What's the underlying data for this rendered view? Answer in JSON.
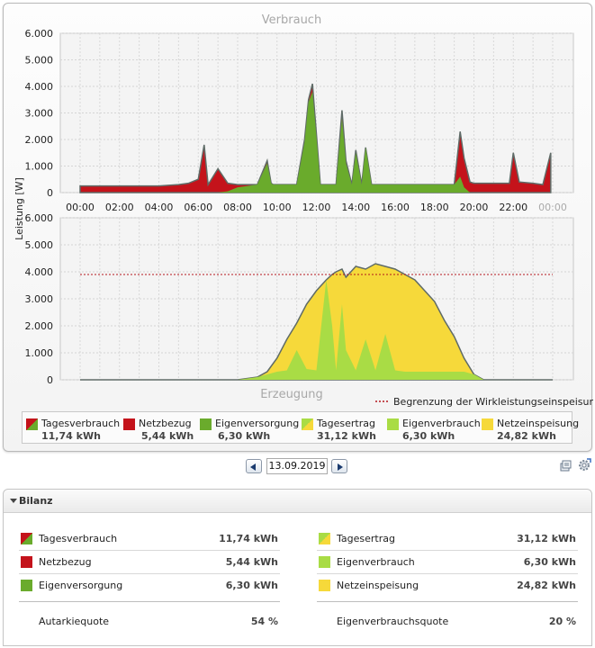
{
  "colors": {
    "red": "#c4131b",
    "green": "#6aab2c",
    "yellow": "#f6d93a",
    "lightgreen": "#a9dc45",
    "outline": "#5f6b67",
    "limit": "#b3161c"
  },
  "chart_data": [
    {
      "type": "area",
      "title": "Verbrauch",
      "ylabel": "Leistung [W]",
      "ylim": [
        0,
        6000
      ],
      "yticks": [
        "0",
        "1.000",
        "2.000",
        "3.000",
        "4.000",
        "5.000",
        "6.000"
      ],
      "xticks": [
        "00:00",
        "02:00",
        "04:00",
        "06:00",
        "08:00",
        "10:00",
        "12:00",
        "14:00",
        "16:00",
        "18:00",
        "20:00",
        "22:00",
        "00:00"
      ],
      "x_hours": [
        0,
        1,
        2,
        3,
        4,
        5,
        5.5,
        6,
        6.3,
        6.5,
        7,
        7.5,
        8,
        9,
        9.5,
        9.7,
        9.8,
        10,
        10.5,
        11,
        11.4,
        11.6,
        11.8,
        12,
        12.2,
        12.5,
        13,
        13.3,
        13.5,
        13.8,
        14,
        14.3,
        14.5,
        14.8,
        15,
        15.3,
        15.5,
        16,
        17,
        18,
        19,
        19.3,
        19.5,
        19.8,
        20,
        21,
        21.8,
        22,
        22.3,
        23,
        23.5,
        23.9
      ],
      "series": [
        {
          "name": "Netzbezug",
          "color": "#c4131b",
          "values": [
            250,
            250,
            250,
            250,
            250,
            300,
            350,
            500,
            1800,
            300,
            900,
            350,
            300,
            300,
            1200,
            350,
            300,
            300,
            300,
            300,
            2000,
            3500,
            4100,
            2200,
            300,
            300,
            300,
            3100,
            1200,
            300,
            1600,
            300,
            1700,
            300,
            300,
            300,
            300,
            300,
            300,
            300,
            300,
            2300,
            1300,
            400,
            350,
            350,
            350,
            1500,
            400,
            350,
            300,
            1500
          ]
        },
        {
          "name": "Eigenversorgung",
          "color": "#6aab2c",
          "values": [
            0,
            0,
            0,
            0,
            0,
            0,
            0,
            0,
            0,
            0,
            0,
            50,
            200,
            300,
            1100,
            350,
            300,
            300,
            300,
            300,
            1900,
            3400,
            3800,
            2100,
            300,
            300,
            300,
            2800,
            1100,
            300,
            1500,
            300,
            1700,
            300,
            300,
            300,
            300,
            300,
            300,
            300,
            300,
            600,
            200,
            0,
            0,
            0,
            0,
            0,
            0,
            0,
            0,
            0
          ]
        }
      ]
    },
    {
      "type": "area",
      "title": "Erzeugung",
      "ylabel": "Leistung [W]",
      "ylim": [
        0,
        6000
      ],
      "yticks": [
        "0",
        "1.000",
        "2.000",
        "3.000",
        "4.000",
        "5.000",
        "6.000"
      ],
      "limit_value": 3900,
      "limit_label": "Begrenzung der Wirkleistungseinspeisung",
      "x_hours": [
        0,
        6.5,
        7,
        7.5,
        8,
        8.5,
        9,
        9.5,
        10,
        10.5,
        11,
        11.5,
        12,
        12.5,
        12.8,
        13,
        13.3,
        13.5,
        14,
        14.5,
        15,
        15.5,
        16,
        16.5,
        17,
        17.5,
        18,
        18.5,
        19,
        19.5,
        20,
        20.5,
        21,
        22,
        23,
        24
      ],
      "series": [
        {
          "name": "Tagesertrag",
          "color": "#f6d93a",
          "values": [
            0,
            0,
            0,
            0,
            0,
            50,
            100,
            300,
            800,
            1500,
            2100,
            2800,
            3300,
            3700,
            3900,
            4000,
            4100,
            3800,
            4200,
            4100,
            4300,
            4200,
            4100,
            3900,
            3700,
            3300,
            2900,
            2200,
            1600,
            800,
            200,
            0,
            0,
            0,
            0,
            0
          ]
        },
        {
          "name": "Eigenverbrauch",
          "color": "#a9dc45",
          "values": [
            0,
            0,
            0,
            0,
            0,
            50,
            100,
            200,
            300,
            350,
            1100,
            400,
            350,
            3700,
            2000,
            350,
            2800,
            1100,
            350,
            1500,
            350,
            1700,
            350,
            300,
            300,
            300,
            300,
            300,
            300,
            300,
            200,
            0,
            0,
            0,
            0,
            0
          ]
        }
      ]
    }
  ],
  "legend": [
    {
      "label": "Tagesverbrauch",
      "value": "11,74 kWh",
      "swatch": "red-green"
    },
    {
      "label": "Netzbezug",
      "value": "5,44 kWh",
      "swatch": "red"
    },
    {
      "label": "Eigenversorgung",
      "value": "6,30 kWh",
      "swatch": "green"
    },
    {
      "label": "Tagesertrag",
      "value": "31,12 kWh",
      "swatch": "lightgreen-yellow"
    },
    {
      "label": "Eigenverbrauch",
      "value": "6,30 kWh",
      "swatch": "lightgreen"
    },
    {
      "label": "Netzeinspeisung",
      "value": "24,82 kWh",
      "swatch": "yellow"
    }
  ],
  "date": "13.09.2019",
  "icons": {
    "prev": "chevron-left-icon",
    "next": "chevron-right-icon",
    "export": "export-icon",
    "settings": "gear-icon"
  },
  "bilanz": {
    "title": "Bilanz",
    "left": [
      {
        "label": "Tagesverbrauch",
        "value": "11,74 kWh",
        "swatch": "red-green"
      },
      {
        "label": "Netzbezug",
        "value": "5,44 kWh",
        "swatch": "red"
      },
      {
        "label": "Eigenversorgung",
        "value": "6,30 kWh",
        "swatch": "green"
      }
    ],
    "left_total": {
      "label": "Autarkiequote",
      "value": "54 %"
    },
    "right": [
      {
        "label": "Tagesertrag",
        "value": "31,12 kWh",
        "swatch": "lightgreen-yellow"
      },
      {
        "label": "Eigenverbrauch",
        "value": "6,30 kWh",
        "swatch": "lightgreen"
      },
      {
        "label": "Netzeinspeisung",
        "value": "24,82 kWh",
        "swatch": "yellow"
      }
    ],
    "right_total": {
      "label": "Eigenverbrauchsquote",
      "value": "20 %"
    }
  }
}
